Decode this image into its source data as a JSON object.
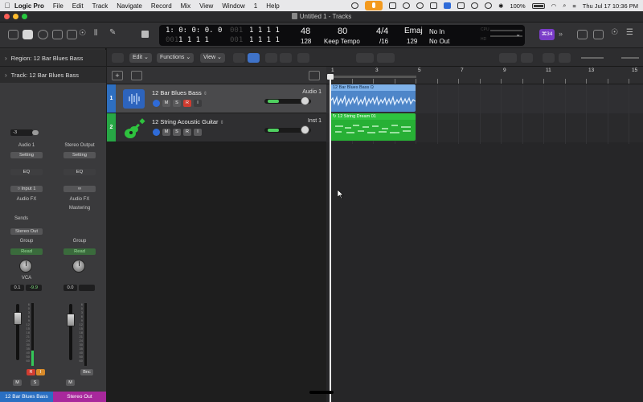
{
  "menubar": {
    "app": "Logic Pro",
    "items": [
      "File",
      "Edit",
      "Track",
      "Navigate",
      "Record",
      "Mix",
      "View",
      "Window",
      "1",
      "Help"
    ],
    "battery": "100%",
    "datetime": "Thu Jul 17  10:36 PM"
  },
  "window": {
    "title": "Untitled 1 - Tracks"
  },
  "lcd": {
    "position_smpte": "1:  0:  0:  0.  0",
    "position_smpte_dim": "001",
    "position_bars": "1  1  1  1",
    "position_bars2": "1  1  1    1",
    "position_bars2_dim": "001",
    "sub_smpte": "1  1  1  1",
    "sub_smpte_dim": "001",
    "sub_bars": "1  1  1    1",
    "sub_bars_dim": "001",
    "bar_value": "48",
    "bar_sub": "128",
    "tempo": "80",
    "tempo_mode": "Keep Tempo",
    "signature": "4/4",
    "division": "/16",
    "key": "Emaj",
    "key_sub": "129",
    "midi_in": "No In",
    "midi_out": "No Out",
    "badge": "⌘34",
    "cpu_label": "CPU",
    "hd_label": "HD"
  },
  "inspector": {
    "region_label": "Region:",
    "region_name": "12 Bar Blues Bass",
    "track_label": "Track:",
    "track_name": "12 Bar Blues Bass"
  },
  "strip1": {
    "gain": "-3",
    "input_label": "Audio 1",
    "setting": "Setting",
    "eq": "EQ",
    "input": "Input 1",
    "fx": "Audio FX",
    "sends": "Sends",
    "output": "Stereo Out",
    "group": "Group",
    "automation": "Read",
    "vca": "VCA",
    "volume": "0.1",
    "peak": "-9.9",
    "r_btn": "R",
    "i_btn": "I",
    "m_btn": "M",
    "s_btn": "S",
    "name": "12 Bar Blues Bass",
    "meter_level": 0.25
  },
  "strip2": {
    "input_label": "Stereo Output",
    "setting": "Setting",
    "eq": "EQ",
    "fx": "Audio FX",
    "fx2": "Mastering",
    "group": "Group",
    "automation": "Read",
    "volume": "0.0",
    "m_btn": "M",
    "bnc_btn": "Bnc",
    "name": "Stereo Out",
    "meter_level": 0.0
  },
  "toolbar": {
    "edit": "Edit",
    "functions": "Functions",
    "view": "View"
  },
  "tracks": [
    {
      "num": "1",
      "name": "12 Bar Blues Bass",
      "output": "Audio 1",
      "m": "M",
      "s": "S",
      "r": "R",
      "i": "I",
      "volume": 0.25
    },
    {
      "num": "2",
      "name": "12 String Acoustic Guitar",
      "output": "Inst 1",
      "m": "M",
      "s": "S",
      "r": "R",
      "i": "I",
      "volume": 0.0
    }
  ],
  "ruler": {
    "bars": [
      "1",
      "3",
      "5",
      "7",
      "9",
      "11",
      "13",
      "15"
    ]
  },
  "regions": [
    {
      "name": "12 Bar Blues Bass",
      "type": "audio"
    },
    {
      "name": "12 String Dream 01",
      "type": "midi"
    }
  ],
  "colors": {
    "audio_track": "#2e6fc0",
    "inst_track": "#27a745",
    "record": "#d13c30",
    "accent": "#3f73c9",
    "purple_badge": "#7a3cc8"
  }
}
